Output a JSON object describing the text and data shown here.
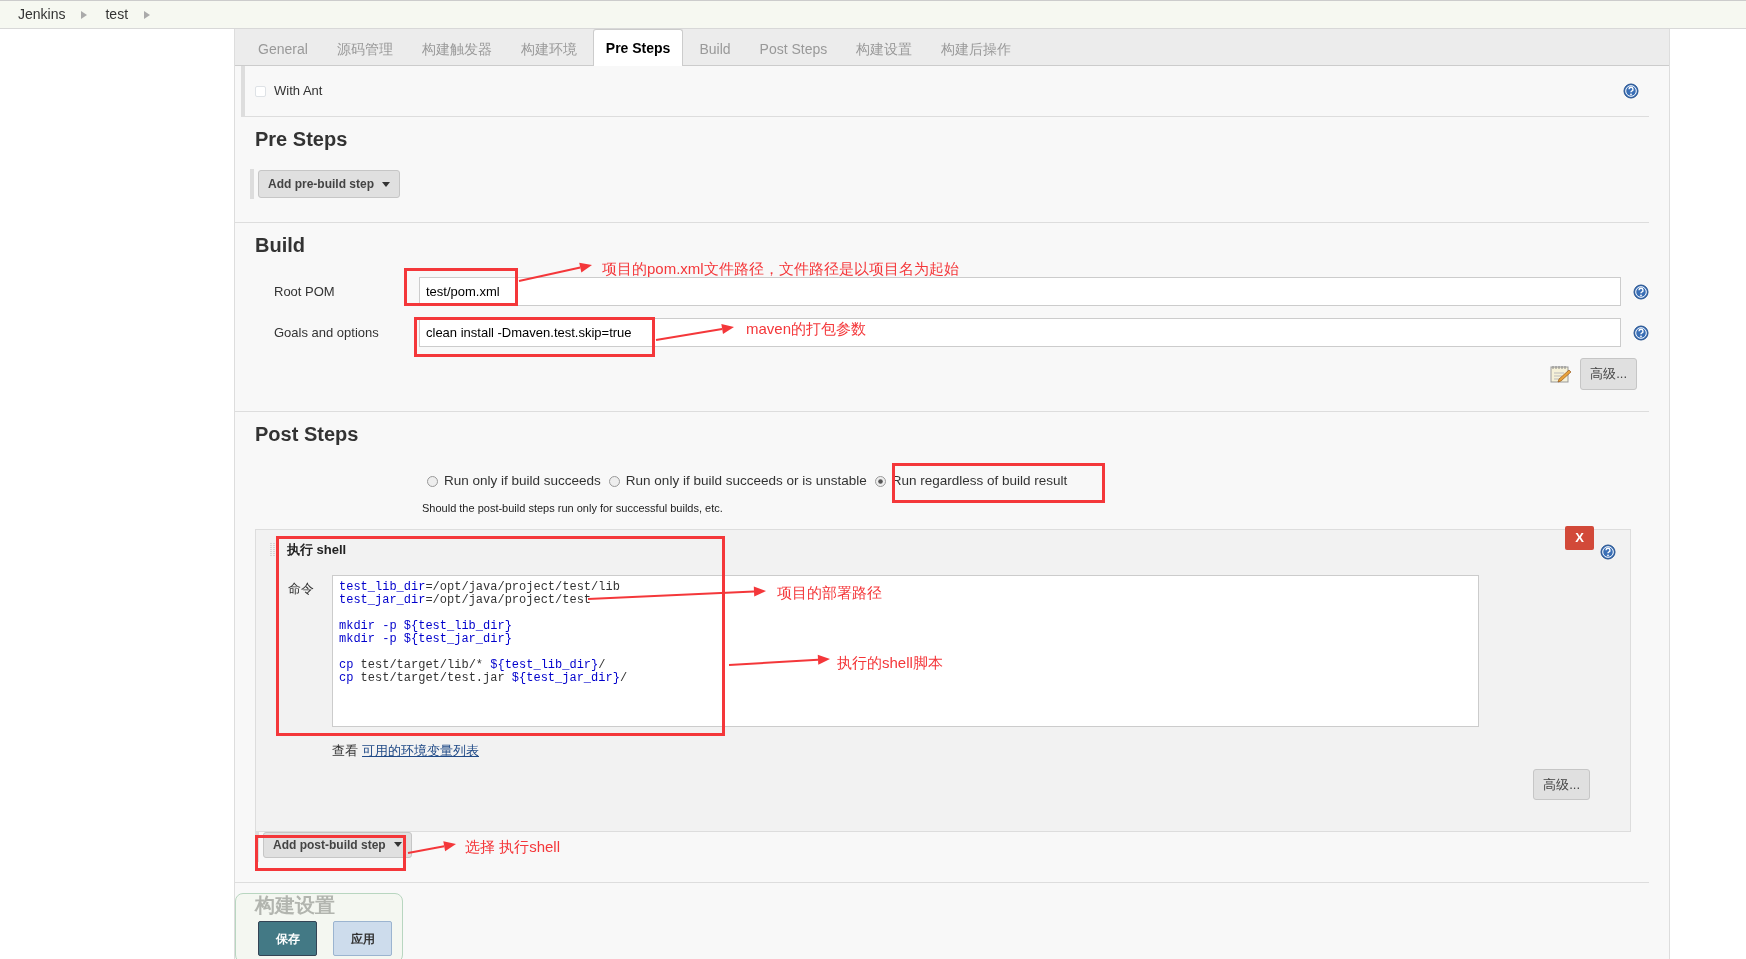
{
  "breadcrumbs": [
    {
      "label": "Jenkins"
    },
    {
      "label": "test"
    }
  ],
  "tabs": [
    {
      "label": "General",
      "selected": false
    },
    {
      "label": "源码管理",
      "selected": false
    },
    {
      "label": "构建触发器",
      "selected": false
    },
    {
      "label": "构建环境",
      "selected": false
    },
    {
      "label": "Pre Steps",
      "selected": true
    },
    {
      "label": "Build",
      "selected": false
    },
    {
      "label": "Post Steps",
      "selected": false
    },
    {
      "label": "构建设置",
      "selected": false
    },
    {
      "label": "构建后操作",
      "selected": false
    }
  ],
  "with_ant": {
    "label": "With Ant",
    "checked": false
  },
  "pre_steps": {
    "title": "Pre Steps",
    "add_button": "Add pre-build step"
  },
  "build": {
    "title": "Build",
    "fields": [
      {
        "label": "Root POM",
        "value": "test/pom.xml"
      },
      {
        "label": "Goals and options",
        "value": "clean install -Dmaven.test.skip=true"
      }
    ],
    "advanced_button": "高级..."
  },
  "post_steps": {
    "title": "Post Steps",
    "options": [
      {
        "label": "Run only if build succeeds",
        "selected": false
      },
      {
        "label": "Run only if build succeeds or is unstable",
        "selected": false
      },
      {
        "label": "Run regardless of build result",
        "selected": true
      }
    ],
    "hint": "Should the post-build steps run only for successful builds, etc.",
    "shell": {
      "title": "执行 shell",
      "delete_button": "X",
      "command_label": "命令",
      "code_blocks": [
        [
          [
            {
              "kind": "var",
              "text": "test_lib_dir"
            },
            {
              "kind": "plain",
              "text": "=/opt/java/project/test/lib"
            }
          ],
          [
            {
              "kind": "var",
              "text": "test_jar_dir"
            },
            {
              "kind": "plain",
              "text": "=/opt/java/project/test"
            }
          ]
        ],
        [
          [
            {
              "kind": "var",
              "text": "mkdir -p ${test_lib_dir}"
            }
          ],
          [
            {
              "kind": "var",
              "text": "mkdir -p ${test_jar_dir}"
            }
          ]
        ],
        [
          [
            {
              "kind": "var",
              "text": "cp"
            },
            {
              "kind": "plain",
              "text": " test/target/lib/* "
            },
            {
              "kind": "var",
              "text": "${test_lib_dir}"
            },
            {
              "kind": "plain",
              "text": "/"
            }
          ],
          [
            {
              "kind": "var",
              "text": "cp"
            },
            {
              "kind": "plain",
              "text": " test/target/test.jar "
            },
            {
              "kind": "var",
              "text": "${test_jar_dir}"
            },
            {
              "kind": "plain",
              "text": "/"
            }
          ]
        ]
      ],
      "env_prefix": "查看",
      "env_link": "可用的环境变量列表",
      "advanced_button": "高级..."
    },
    "add_button": "Add post-build step"
  },
  "next_section": {
    "title": "构建设置"
  },
  "save_bar": {
    "save": "保存",
    "apply": "应用"
  },
  "annotations": [
    {
      "text": "项目的pom.xml文件路径，文件路径是以项目名为起始"
    },
    {
      "text": "maven的打包参数"
    },
    {
      "text": "项目的部署路径"
    },
    {
      "text": "执行的shell脚本"
    },
    {
      "text": "选择 执行shell"
    }
  ]
}
